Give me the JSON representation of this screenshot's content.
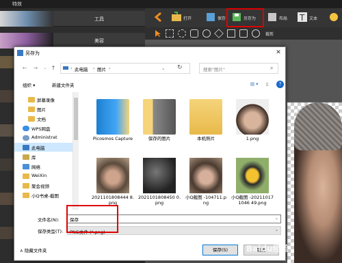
{
  "editor": {
    "title": "特效",
    "tabs": [
      "工具",
      "美容"
    ],
    "toolbar": {
      "open": "打开",
      "save": "保存",
      "save_as": "另存为",
      "layout": "布局",
      "text": "文本"
    },
    "toolbar2": {
      "crop": "裁剪"
    }
  },
  "dialog": {
    "title": "另存为",
    "close": "✕",
    "nav": {
      "back": "←",
      "forward": "→",
      "up": "↑",
      "refresh": "↻"
    },
    "breadcrumb": [
      "此电脑",
      "图片"
    ],
    "search_placeholder": "搜索\"图片\"",
    "commands": {
      "organize": "组织 ▾",
      "new_folder": "新建文件夹"
    },
    "tree": [
      {
        "label": "屏幕录像",
        "icon": "folder-icon"
      },
      {
        "label": "图片",
        "icon": "folder-icon"
      },
      {
        "label": "文档",
        "icon": "folder-icon"
      },
      {
        "label": "WPS网盘",
        "icon": "cloud-icon"
      },
      {
        "label": "Administrat",
        "icon": "user-icon"
      },
      {
        "label": "此电脑",
        "icon": "computer-icon"
      },
      {
        "label": "库",
        "icon": "library-icon"
      },
      {
        "label": "网络",
        "icon": "network-icon"
      },
      {
        "label": "WeiXin",
        "icon": "folder-icon"
      },
      {
        "label": "聚会视频",
        "icon": "folder-icon"
      },
      {
        "label": "小Q书桌-截图",
        "icon": "folder-icon"
      }
    ],
    "files": [
      {
        "name": "Picosmos Capture",
        "type": "folder"
      },
      {
        "name": "保存的图片",
        "type": "folder"
      },
      {
        "name": "本机照片",
        "type": "folder"
      },
      {
        "name": "1.png",
        "type": "image"
      },
      {
        "name": "2021101808444 8.png",
        "type": "image"
      },
      {
        "name": "2021101808450 0.png",
        "type": "image"
      },
      {
        "name": "小Q截图 -104711.png",
        "type": "image"
      },
      {
        "name": "小Q截图 -202110171046 49.png",
        "type": "image"
      }
    ],
    "filename_label": "文件名(N):",
    "filename_value": "保存",
    "filetype_label": "保存类型(T):",
    "filetype_value": "PNG文件 (*.png)",
    "hide_folders": "∧ 隐藏文件夹",
    "save_button": "保存(S)",
    "cancel_button": "取消"
  },
  "watermark": "Baidu经验"
}
